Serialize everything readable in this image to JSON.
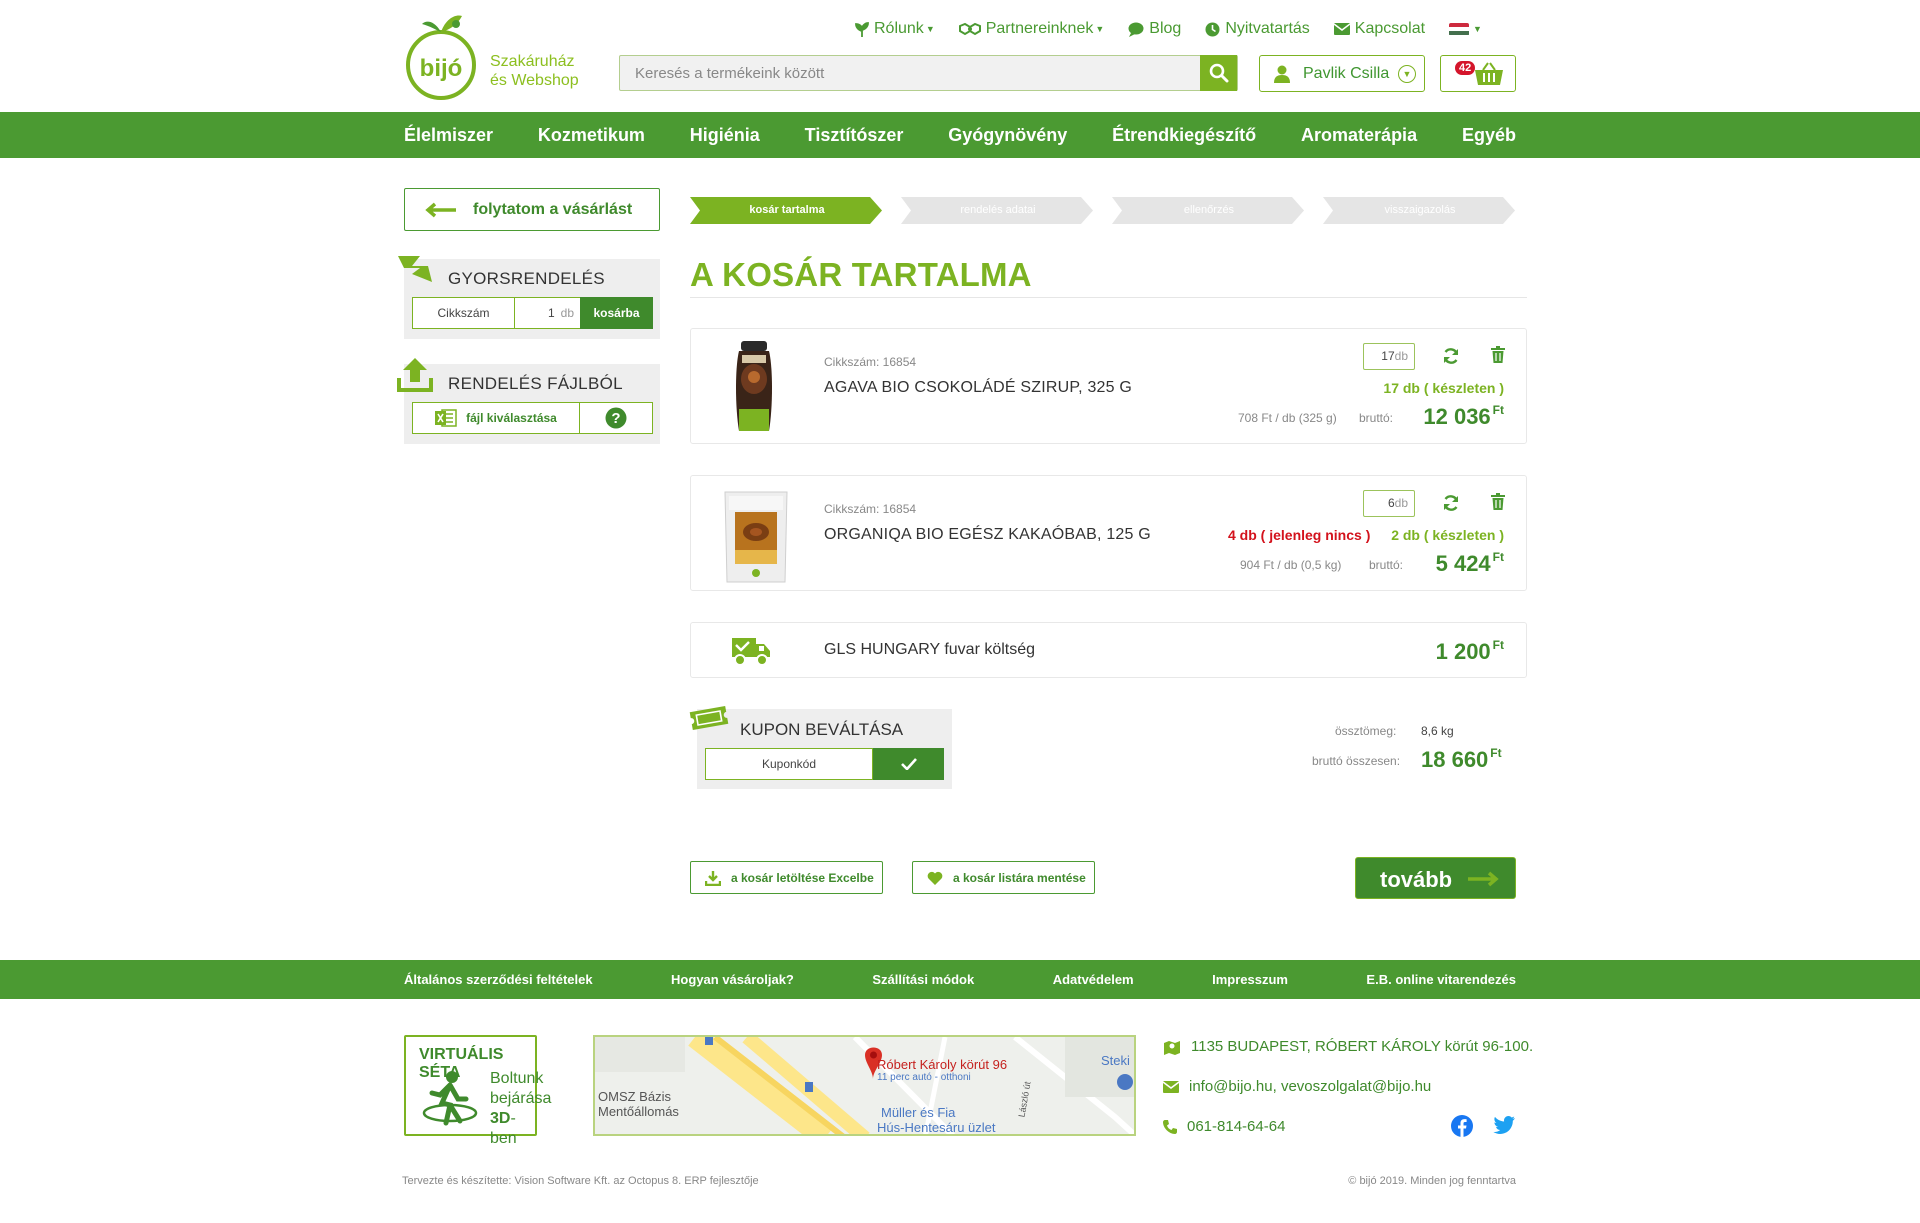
{
  "header": {
    "tagline_line1": "Szakáruház",
    "tagline_line2": "és Webshop",
    "logo_text": "bijó",
    "topnav": [
      {
        "label": "Rólunk",
        "icon": "leaf-icon",
        "dropdown": true
      },
      {
        "label": "Partnereinknek",
        "icon": "handshake-icon",
        "dropdown": true
      },
      {
        "label": "Blog",
        "icon": "chat-icon",
        "dropdown": false
      },
      {
        "label": "Nyitvatartás",
        "icon": "clock-icon",
        "dropdown": false
      },
      {
        "label": "Kapcsolat",
        "icon": "envelope-icon",
        "dropdown": false
      }
    ],
    "search_placeholder": "Keresés a termékeink között",
    "user_name": "Pavlik Csilla",
    "cart_count": "42"
  },
  "mainnav": [
    "Élelmiszer",
    "Kozmetikum",
    "Higiénia",
    "Tisztítószer",
    "Gyógynövény",
    "Étrendkiegészítő",
    "Aromaterápia",
    "Egyéb"
  ],
  "sidebar": {
    "continue_label": "folytatom a vásárlást",
    "quick_title": "GYORSRENDELÉS",
    "quick_sku_placeholder": "Cikkszám",
    "quick_qty": "1",
    "quick_unit": "db",
    "quick_button": "kosárba",
    "file_title": "RENDELÉS FÁJLBÓL",
    "file_button": "fájl kiválasztása"
  },
  "steps": [
    {
      "label": "kosár tartalma",
      "active": true
    },
    {
      "label": "rendelés adatai",
      "active": false
    },
    {
      "label": "ellenőrzés",
      "active": false
    },
    {
      "label": "visszaigazolás",
      "active": false
    }
  ],
  "page_title": "A KOSÁR TARTALMA",
  "items": [
    {
      "sku": "Cikkszám: 16854",
      "name": "AGAVA BIO CSOKOLÁDÉ SZIRUP, 325 G",
      "qty": "17",
      "unit": "db",
      "stock": "17 db ( készleten )",
      "nostock": "",
      "unit_price": "708 Ft / db (325 g)",
      "brutto_label": "bruttó:",
      "price": "12 036",
      "currency": "Ft"
    },
    {
      "sku": "Cikkszám: 16854",
      "name": "ORGANIQA BIO EGÉSZ KAKAÓBAB, 125 G",
      "qty": "6",
      "unit": "db",
      "stock": "2 db ( készleten )",
      "nostock": "4 db ( jelenleg nincs )",
      "unit_price": "904 Ft / db (0,5 kg)",
      "brutto_label": "bruttó:",
      "price": "5 424",
      "currency": "Ft"
    }
  ],
  "shipping": {
    "label": "GLS HUNGARY fuvar költség",
    "price": "1 200",
    "currency": "Ft"
  },
  "coupon": {
    "title": "KUPON BEVÁLTÁSA",
    "placeholder": "Kuponkód"
  },
  "totals": {
    "weight_label": "össztömeg:",
    "weight_value": "8,6 kg",
    "total_label": "bruttó összesen:",
    "total_value": "18 660",
    "currency": "Ft"
  },
  "actions": {
    "excel_label": "a kosár letöltése Excelbe",
    "list_label": "a kosár listára mentése",
    "next_label": "tovább"
  },
  "footer": {
    "links": [
      "Általános szerződési feltételek",
      "Hogyan vásároljak?",
      "Szállítási módok",
      "Adatvédelem",
      "Impresszum",
      "E.B.  online vitarendezés"
    ],
    "tour_title": "VIRTUÁLIS SÉTA",
    "tour_line1": "Boltunk",
    "tour_line2": "bejárása",
    "tour_line3_bold": "3D",
    "tour_line3_rest": "-ben",
    "map_pin_title": "Róbert Károly körút 96",
    "map_pin_sub": "11 perc autó - otthoni",
    "map_label1": "OMSZ Bázis",
    "map_label2": "Mentőállomás",
    "map_label3": "Müller és Fia",
    "map_label4": "Hús-Hentesáru üzlet",
    "map_label5": "Steki",
    "map_street": "László út",
    "address": "1135 BUDAPEST, RÓBERT KÁROLY körút 96-100.",
    "email": "info@bijo.hu, vevoszolgalat@bijo.hu",
    "phone": "061-814-64-64",
    "credit_left": "Tervezte és készítette: Vision Software Kft. az Octopus 8. ERP fejlesztője",
    "credit_right": "© bijó 2019. Minden jog fenntartva"
  },
  "colors": {
    "primary_green": "#4b9a32",
    "light_green": "#7cb322",
    "dark_green": "#3f8a2c",
    "red": "#d3121c",
    "grey_panel": "#eeeeee"
  }
}
